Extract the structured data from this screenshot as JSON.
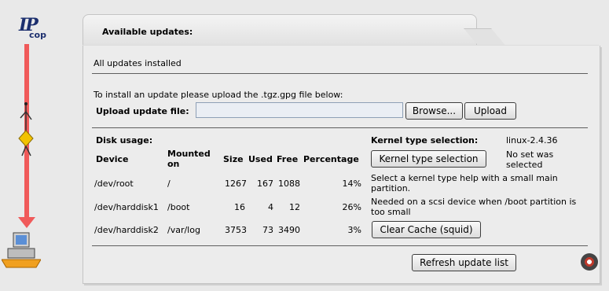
{
  "logo": {
    "text_top": "IP",
    "text_bottom": "cop"
  },
  "section": {
    "title": "Available updates:"
  },
  "status": "All updates installed",
  "upload": {
    "instruction": "To install an update please upload the .tgz.gpg file below:",
    "label": "Upload update file:",
    "value": "",
    "browse_label": "Browse...",
    "upload_label": "Upload"
  },
  "disk": {
    "heading": "Disk usage:",
    "columns": {
      "device": "Device",
      "mounted_line1": "Mounted",
      "mounted_line2": "on",
      "size": "Size",
      "used": "Used",
      "free": "Free",
      "percentage": "Percentage"
    },
    "rows": [
      {
        "device": "/dev/root",
        "mounted": "/",
        "size": "1267",
        "used": "167",
        "free": "1088",
        "percentage": "14%"
      },
      {
        "device": "/dev/harddisk1",
        "mounted": "/boot",
        "size": "16",
        "used": "4",
        "free": "12",
        "percentage": "26%"
      },
      {
        "device": "/dev/harddisk2",
        "mounted": "/var/log",
        "size": "3753",
        "used": "73",
        "free": "3490",
        "percentage": "3%"
      }
    ]
  },
  "kernel": {
    "heading": "Kernel type selection:",
    "current": "linux-2.4.36",
    "status_line1": "No set was",
    "status_line2": "selected",
    "button_label": "Kernel type selection",
    "help1_line1": "Select a kernel type help with a small main",
    "help1_line2": "partition.",
    "help2_line1": "Needed on a scsi device when /boot partition is",
    "help2_line2": "too small",
    "clear_cache_label": "Clear Cache (squid)"
  },
  "refresh_label": "Refresh update list",
  "colors": {
    "accent_arrow": "#f05a5a",
    "panel_bg": "#ececec",
    "page_bg": "#e9e9e9"
  }
}
